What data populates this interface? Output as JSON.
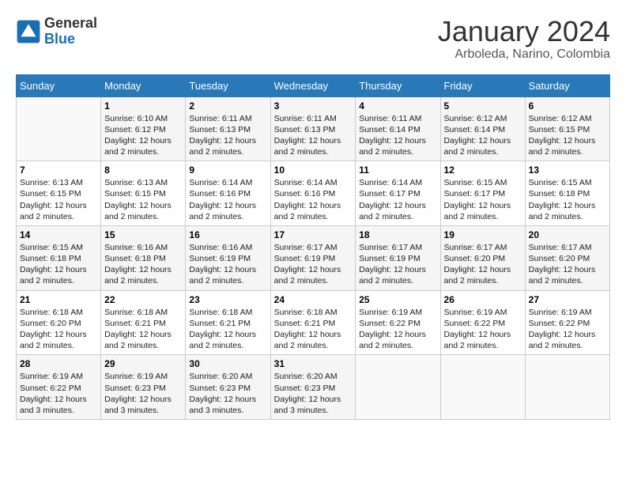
{
  "logo": {
    "general": "General",
    "blue": "Blue"
  },
  "header": {
    "month": "January 2024",
    "location": "Arboleda, Narino, Colombia"
  },
  "weekdays": [
    "Sunday",
    "Monday",
    "Tuesday",
    "Wednesday",
    "Thursday",
    "Friday",
    "Saturday"
  ],
  "weeks": [
    [
      {
        "day": "",
        "info": ""
      },
      {
        "day": "1",
        "info": "Sunrise: 6:10 AM\nSunset: 6:12 PM\nDaylight: 12 hours\nand 2 minutes."
      },
      {
        "day": "2",
        "info": "Sunrise: 6:11 AM\nSunset: 6:13 PM\nDaylight: 12 hours\nand 2 minutes."
      },
      {
        "day": "3",
        "info": "Sunrise: 6:11 AM\nSunset: 6:13 PM\nDaylight: 12 hours\nand 2 minutes."
      },
      {
        "day": "4",
        "info": "Sunrise: 6:11 AM\nSunset: 6:14 PM\nDaylight: 12 hours\nand 2 minutes."
      },
      {
        "day": "5",
        "info": "Sunrise: 6:12 AM\nSunset: 6:14 PM\nDaylight: 12 hours\nand 2 minutes."
      },
      {
        "day": "6",
        "info": "Sunrise: 6:12 AM\nSunset: 6:15 PM\nDaylight: 12 hours\nand 2 minutes."
      }
    ],
    [
      {
        "day": "7",
        "info": "Sunrise: 6:13 AM\nSunset: 6:15 PM\nDaylight: 12 hours\nand 2 minutes."
      },
      {
        "day": "8",
        "info": "Sunrise: 6:13 AM\nSunset: 6:15 PM\nDaylight: 12 hours\nand 2 minutes."
      },
      {
        "day": "9",
        "info": "Sunrise: 6:14 AM\nSunset: 6:16 PM\nDaylight: 12 hours\nand 2 minutes."
      },
      {
        "day": "10",
        "info": "Sunrise: 6:14 AM\nSunset: 6:16 PM\nDaylight: 12 hours\nand 2 minutes."
      },
      {
        "day": "11",
        "info": "Sunrise: 6:14 AM\nSunset: 6:17 PM\nDaylight: 12 hours\nand 2 minutes."
      },
      {
        "day": "12",
        "info": "Sunrise: 6:15 AM\nSunset: 6:17 PM\nDaylight: 12 hours\nand 2 minutes."
      },
      {
        "day": "13",
        "info": "Sunrise: 6:15 AM\nSunset: 6:18 PM\nDaylight: 12 hours\nand 2 minutes."
      }
    ],
    [
      {
        "day": "14",
        "info": "Sunrise: 6:15 AM\nSunset: 6:18 PM\nDaylight: 12 hours\nand 2 minutes."
      },
      {
        "day": "15",
        "info": "Sunrise: 6:16 AM\nSunset: 6:18 PM\nDaylight: 12 hours\nand 2 minutes."
      },
      {
        "day": "16",
        "info": "Sunrise: 6:16 AM\nSunset: 6:19 PM\nDaylight: 12 hours\nand 2 minutes."
      },
      {
        "day": "17",
        "info": "Sunrise: 6:17 AM\nSunset: 6:19 PM\nDaylight: 12 hours\nand 2 minutes."
      },
      {
        "day": "18",
        "info": "Sunrise: 6:17 AM\nSunset: 6:19 PM\nDaylight: 12 hours\nand 2 minutes."
      },
      {
        "day": "19",
        "info": "Sunrise: 6:17 AM\nSunset: 6:20 PM\nDaylight: 12 hours\nand 2 minutes."
      },
      {
        "day": "20",
        "info": "Sunrise: 6:17 AM\nSunset: 6:20 PM\nDaylight: 12 hours\nand 2 minutes."
      }
    ],
    [
      {
        "day": "21",
        "info": "Sunrise: 6:18 AM\nSunset: 6:20 PM\nDaylight: 12 hours\nand 2 minutes."
      },
      {
        "day": "22",
        "info": "Sunrise: 6:18 AM\nSunset: 6:21 PM\nDaylight: 12 hours\nand 2 minutes."
      },
      {
        "day": "23",
        "info": "Sunrise: 6:18 AM\nSunset: 6:21 PM\nDaylight: 12 hours\nand 2 minutes."
      },
      {
        "day": "24",
        "info": "Sunrise: 6:18 AM\nSunset: 6:21 PM\nDaylight: 12 hours\nand 2 minutes."
      },
      {
        "day": "25",
        "info": "Sunrise: 6:19 AM\nSunset: 6:22 PM\nDaylight: 12 hours\nand 2 minutes."
      },
      {
        "day": "26",
        "info": "Sunrise: 6:19 AM\nSunset: 6:22 PM\nDaylight: 12 hours\nand 2 minutes."
      },
      {
        "day": "27",
        "info": "Sunrise: 6:19 AM\nSunset: 6:22 PM\nDaylight: 12 hours\nand 2 minutes."
      }
    ],
    [
      {
        "day": "28",
        "info": "Sunrise: 6:19 AM\nSunset: 6:22 PM\nDaylight: 12 hours\nand 3 minutes."
      },
      {
        "day": "29",
        "info": "Sunrise: 6:19 AM\nSunset: 6:23 PM\nDaylight: 12 hours\nand 3 minutes."
      },
      {
        "day": "30",
        "info": "Sunrise: 6:20 AM\nSunset: 6:23 PM\nDaylight: 12 hours\nand 3 minutes."
      },
      {
        "day": "31",
        "info": "Sunrise: 6:20 AM\nSunset: 6:23 PM\nDaylight: 12 hours\nand 3 minutes."
      },
      {
        "day": "",
        "info": ""
      },
      {
        "day": "",
        "info": ""
      },
      {
        "day": "",
        "info": ""
      }
    ]
  ]
}
